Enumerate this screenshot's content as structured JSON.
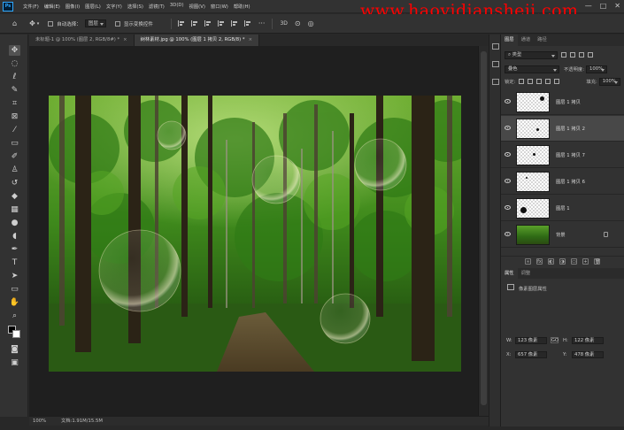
{
  "app": {
    "logo": "Ps"
  },
  "menu": [
    "文件(F)",
    "编辑(E)",
    "图像(I)",
    "图层(L)",
    "文字(Y)",
    "选择(S)",
    "滤镜(T)",
    "3D(D)",
    "视图(V)",
    "窗口(W)",
    "帮助(H)"
  ],
  "watermark": "www.haoyidiansheji.com",
  "window_controls": {
    "minimize": "—",
    "maximize": "□",
    "close": "✕"
  },
  "options_bar": {
    "auto_select_label": "自动选择：",
    "auto_select_value": "图层",
    "show_transform_label": "显示变换控件"
  },
  "tabs": [
    {
      "title": "未标题-1 @ 100% (图层 2, RGB/8#) *",
      "active": false,
      "close": "×"
    },
    {
      "title": "树林素材.jpg @ 100% (图层 1 拷贝 2, RGB/8) *",
      "active": true,
      "close": "×"
    }
  ],
  "status": {
    "zoom": "100%",
    "doc": "文档:1.91M/15.5M"
  },
  "panel": {
    "tabs": [
      "图层",
      "通道",
      "路径"
    ],
    "filter_label": "类型",
    "blend_mode": "叠色",
    "opacity_label": "不透明度:",
    "opacity_value": "100%",
    "lock_label": "锁定:",
    "fill_label": "填充:",
    "fill_value": "100%"
  },
  "layers": [
    {
      "name": "图层 1 拷贝",
      "selected": false,
      "locked": false,
      "eye": true
    },
    {
      "name": "图层 1 拷贝 2",
      "selected": true,
      "locked": false,
      "eye": true
    },
    {
      "name": "图层 1 拷贝 7",
      "selected": false,
      "locked": false,
      "eye": true
    },
    {
      "name": "图层 1 拷贝 6",
      "selected": false,
      "locked": false,
      "eye": true
    },
    {
      "name": "图层 1",
      "selected": false,
      "locked": false,
      "eye": true
    },
    {
      "name": "背景",
      "selected": false,
      "locked": true,
      "eye": true
    }
  ],
  "layer_footer": [
    "∞",
    "fx",
    "◐",
    "◑",
    "▭",
    "+",
    "🗑"
  ],
  "properties": {
    "tabs": [
      "属性",
      "调整"
    ],
    "title": "像素图层属性",
    "w_label": "W:",
    "w_value": "123 像素",
    "h_label": "H:",
    "h_value": "122 像素",
    "x_label": "X:",
    "x_value": "657 像素",
    "y_label": "Y:",
    "y_value": "478 像素",
    "link": "GO"
  }
}
